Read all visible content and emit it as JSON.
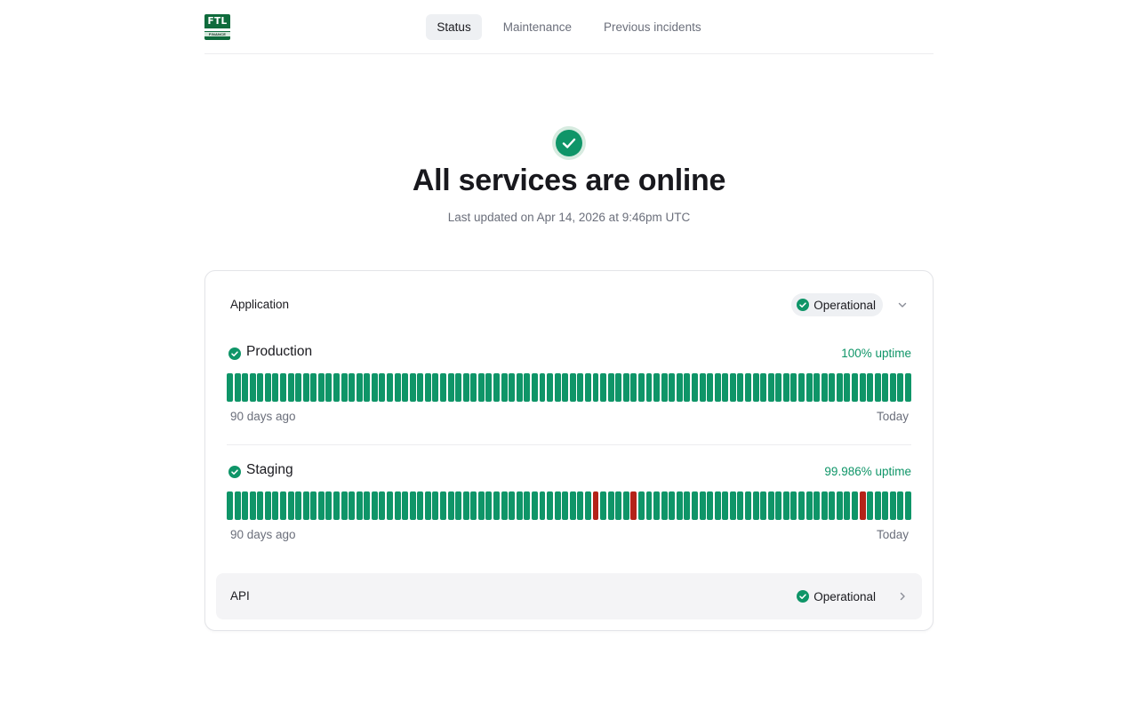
{
  "logo": {
    "text": "FTL",
    "subtext": "FINANCE",
    "color": "#0f6b3c"
  },
  "nav": {
    "items": [
      {
        "label": "Status",
        "active": true
      },
      {
        "label": "Maintenance",
        "active": false
      },
      {
        "label": "Previous incidents",
        "active": false
      }
    ]
  },
  "hero": {
    "icon": "check-circle-icon",
    "title": "All services are online",
    "subtitle": "Last updated on Apr 14, 2026 at 9:46pm UTC"
  },
  "colors": {
    "ok": "#0f9568",
    "incident": "#b42318",
    "text_muted": "#6b6f7b"
  },
  "groups": [
    {
      "name": "Application",
      "status": "Operational",
      "expanded": true,
      "services": [
        {
          "name": "Production",
          "uptime": "100% uptime",
          "start_label": "90 days ago",
          "end_label": "Today",
          "incident_days": []
        },
        {
          "name": "Staging",
          "uptime": "99.986% uptime",
          "start_label": "90 days ago",
          "end_label": "Today",
          "incident_days": [
            48,
            53,
            83
          ]
        }
      ]
    },
    {
      "name": "API",
      "status": "Operational",
      "expanded": false,
      "services": []
    }
  ],
  "days_shown": 90
}
